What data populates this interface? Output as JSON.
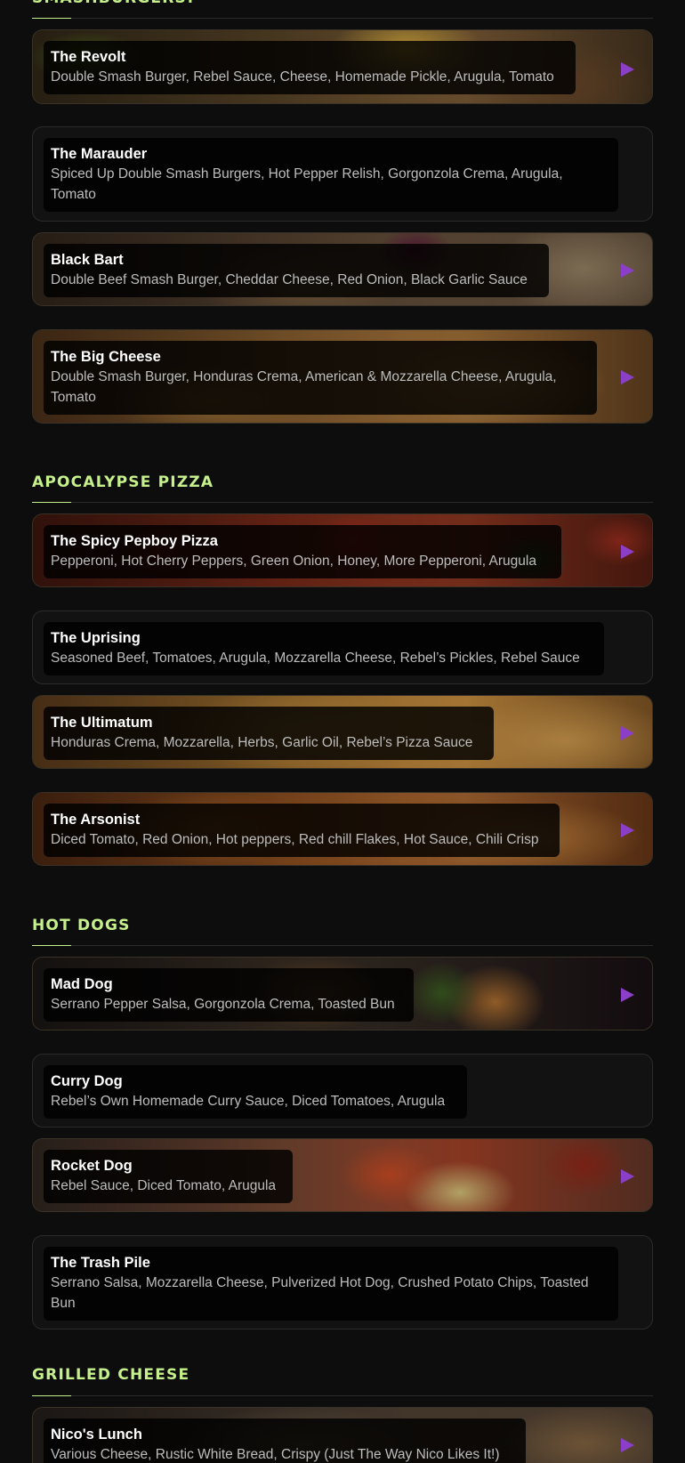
{
  "sections": {
    "smashburgers": {
      "title": "SMASHBURGERS!"
    },
    "pizza": {
      "title": "APOCALYPSE PIZZA"
    },
    "hotdogs": {
      "title": "HOT DOGS"
    },
    "grilled": {
      "title": "GRILLED CHEESE"
    }
  },
  "items": {
    "revolt": {
      "name": "The Revolt",
      "desc": "Double Smash Burger, Rebel Sauce, Cheese, Homemade Pickle, Arugula, Tomato"
    },
    "marauder": {
      "name": "The Marauder",
      "desc": "Spiced Up Double Smash Burgers, Hot Pepper Relish, Gorgonzola Crema, Arugula, Tomato"
    },
    "blackbart": {
      "name": "Black Bart",
      "desc": "Double Beef Smash Burger, Cheddar Cheese, Red Onion, Black Garlic Sauce"
    },
    "bigcheese": {
      "name": "The Big Cheese",
      "desc": "Double Smash Burger, Honduras Crema, American & Mozzarella Cheese, Arugula, Tomato"
    },
    "pepboy": {
      "name": "The Spicy Pepboy Pizza",
      "desc": "Pepperoni, Hot Cherry Peppers, Green Onion, Honey, More Pepperoni, Arugula"
    },
    "uprising": {
      "name": "The Uprising",
      "desc": "Seasoned Beef, Tomatoes, Arugula, Mozzarella Cheese, Rebel’s Pickles, Rebel Sauce"
    },
    "ultimatum": {
      "name": "The Ultimatum",
      "desc": "Honduras Crema, Mozzarella, Herbs, Garlic Oil, Rebel’s Pizza Sauce"
    },
    "arsonist": {
      "name": "The Arsonist",
      "desc": "Diced Tomato, Red Onion, Hot peppers, Red chill Flakes, Hot Sauce, Chili Crisp"
    },
    "maddog": {
      "name": "Mad Dog",
      "desc": "Serrano Pepper Salsa, Gorgonzola Crema, Toasted Bun"
    },
    "currydog": {
      "name": "Curry Dog",
      "desc": "Rebel’s Own Homemade Curry Sauce, Diced Tomatoes, Arugula"
    },
    "rocketdog": {
      "name": "Rocket Dog",
      "desc": "Rebel Sauce, Diced Tomato, Arugula"
    },
    "trashpile": {
      "name": "The Trash Pile",
      "desc": "Serrano Salsa, Mozzarella Cheese, Pulverized Hot Dog, Crushed Potato Chips, Toasted Bun"
    },
    "nicoslunch": {
      "name": "Nico's Lunch",
      "desc": "Various Cheese, Rustic White Bread, Crispy (Just The Way Nico Likes It!)"
    }
  },
  "icons": {
    "play": "play-video-icon"
  },
  "colors": {
    "accent": "#c6f08c",
    "play": "#8b3fc9",
    "background": "#0d0d0e"
  }
}
